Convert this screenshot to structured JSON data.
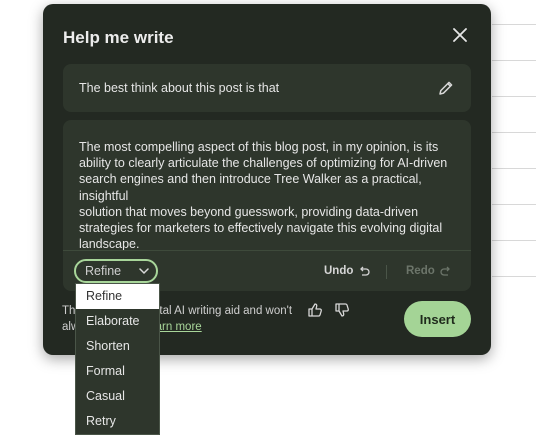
{
  "dialog": {
    "title": "Help me write",
    "close_icon": "close-icon"
  },
  "prompt": {
    "text": "The best think about this post is that",
    "edit_icon": "pencil-icon"
  },
  "result": {
    "lines": [
      "The most compelling aspect of this blog post, in my opinion, is its",
      "ability to clearly articulate the challenges of optimizing for AI-driven",
      "search engines and then introduce Tree Walker as a practical, insightful",
      "solution that moves beyond guesswork, providing data-driven",
      "strategies for marketers to effectively navigate this evolving digital",
      "landscape."
    ]
  },
  "toolbar": {
    "refine_label": "Refine",
    "undo_label": "Undo",
    "redo_label": "Redo"
  },
  "footer": {
    "disclaimer_line1": "Th",
    "disclaimer_line1b": "tal AI writing aid and won't",
    "disclaimer_line2": "alw",
    "learn_more": "earn more",
    "insert_label": "Insert"
  },
  "refine_menu": {
    "items": [
      "Refine",
      "Elaborate",
      "Shorten",
      "Formal",
      "Casual",
      "Retry"
    ],
    "selected": "Refine"
  },
  "colors": {
    "dialog_bg": "#232922",
    "panel_bg": "#2e362c",
    "accent": "#a4d496"
  }
}
